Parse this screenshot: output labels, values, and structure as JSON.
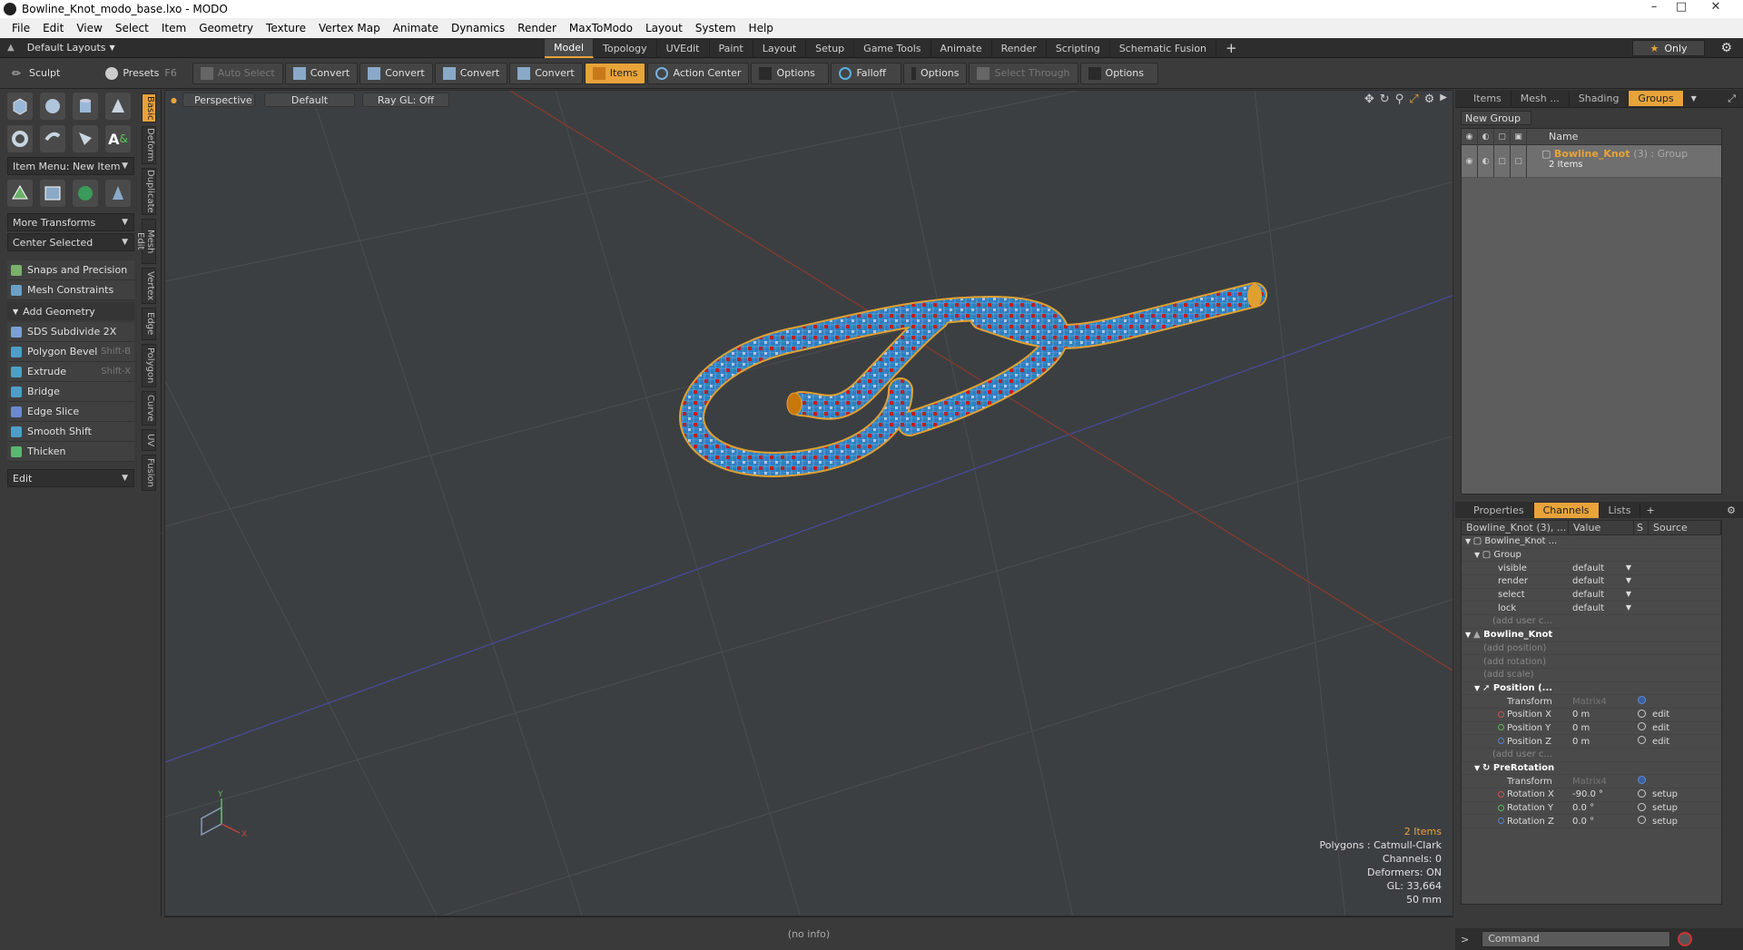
{
  "window": {
    "title": "Bowline_Knot_modo_base.lxo - MODO"
  },
  "menu": [
    "File",
    "Edit",
    "View",
    "Select",
    "Item",
    "Geometry",
    "Texture",
    "Vertex Map",
    "Animate",
    "Dynamics",
    "Render",
    "MaxToModo",
    "Layout",
    "System",
    "Help"
  ],
  "layout": {
    "default_layouts": "Default Layouts",
    "tabs": [
      "Model",
      "Topology",
      "UVEdit",
      "Paint",
      "Layout",
      "Setup",
      "Game Tools",
      "Animate",
      "Render",
      "Scripting",
      "Schematic Fusion"
    ],
    "active_tab": "Model",
    "only_label": "Only"
  },
  "toolbar": {
    "sculpt": "Sculpt",
    "presets": "Presets",
    "presets_key": "F6",
    "auto_select": "Auto Select",
    "convert1": "Convert",
    "convert2": "Convert",
    "convert3": "Convert",
    "convert4": "Convert",
    "items": "Items",
    "action_center": "Action Center",
    "options1": "Options",
    "falloff": "Falloff",
    "options2": "Options",
    "select_through": "Select Through",
    "options3": "Options"
  },
  "left": {
    "item_menu": "Item Menu: New Item",
    "more_transforms": "More Transforms",
    "center_selected": "Center Selected",
    "snaps": "Snaps and Precision",
    "mesh_constraints": "Mesh Constraints",
    "add_geometry": "Add Geometry",
    "tools": [
      {
        "label": "SDS Subdivide 2X",
        "shortcut": "",
        "color": "#7aa0d8"
      },
      {
        "label": "Polygon Bevel",
        "shortcut": "Shift-B",
        "color": "#4aa0c8"
      },
      {
        "label": "Extrude",
        "shortcut": "Shift-X",
        "color": "#4aa0c8"
      },
      {
        "label": "Bridge",
        "shortcut": "",
        "color": "#4aa0c8"
      },
      {
        "label": "Edge Slice",
        "shortcut": "",
        "color": "#6a8ad0"
      },
      {
        "label": "Smooth Shift",
        "shortcut": "",
        "color": "#4aa0c8"
      },
      {
        "label": "Thicken",
        "shortcut": "",
        "color": "#5ab870"
      }
    ],
    "edit_dd": "Edit",
    "vtabs": [
      "Basic",
      "Deform",
      "Duplicate",
      "Mesh Edit",
      "Vertex",
      "Edge",
      "Polygon",
      "Curve",
      "UV",
      "Fusion"
    ]
  },
  "viewport": {
    "view": "Perspective",
    "shading": "Default",
    "raygl": "Ray GL: Off",
    "info": {
      "items": "2 Items",
      "polygons": "Polygons : Catmull-Clark",
      "channels": "Channels: 0",
      "deformers": "Deformers: ON",
      "gl": "GL: 33,664",
      "size": "50 mm"
    },
    "status": "(no info)"
  },
  "right": {
    "tabs": [
      "Items",
      "Mesh ...",
      "Shading",
      "Groups"
    ],
    "active_tab": "Groups",
    "new_group": "New Group",
    "list_header": "Name",
    "group": {
      "name": "Bowline_Knot",
      "suffix": "(3) : Group",
      "count": "2 Items"
    },
    "tabs2": [
      "Properties",
      "Channels",
      "Lists"
    ],
    "active_tab2": "Channels",
    "ch_header": {
      "name": "Bowline_Knot (3), ...",
      "value": "Value",
      "s": "S",
      "source": "Source"
    },
    "channels": [
      {
        "name": "Bowline_Knot ...",
        "value": "",
        "src": "",
        "type": "root"
      },
      {
        "name": "Group",
        "value": "",
        "src": "",
        "type": "node"
      },
      {
        "name": "visible",
        "value": "default",
        "src": "",
        "type": "dd"
      },
      {
        "name": "render",
        "value": "default",
        "src": "",
        "type": "dd"
      },
      {
        "name": "select",
        "value": "default",
        "src": "",
        "type": "dd"
      },
      {
        "name": "lock",
        "value": "default",
        "src": "",
        "type": "dd"
      },
      {
        "name": "(add user c...",
        "value": "",
        "src": "",
        "type": "dim"
      },
      {
        "name": "Bowline_Knot",
        "value": "",
        "src": "",
        "type": "bold"
      },
      {
        "name": "(add position)",
        "value": "",
        "src": "",
        "type": "dim"
      },
      {
        "name": "(add rotation)",
        "value": "",
        "src": "",
        "type": "dim"
      },
      {
        "name": "(add scale)",
        "value": "",
        "src": "",
        "type": "dim"
      },
      {
        "name": "Position (...",
        "value": "",
        "src": "",
        "type": "bold"
      },
      {
        "name": "Transform",
        "value": "Matrix4",
        "src": "",
        "type": "matrix"
      },
      {
        "name": "Position X",
        "value": "0 m",
        "src": "edit",
        "type": "px"
      },
      {
        "name": "Position Y",
        "value": "0 m",
        "src": "edit",
        "type": "py"
      },
      {
        "name": "Position Z",
        "value": "0 m",
        "src": "edit",
        "type": "pz"
      },
      {
        "name": "(add user c...",
        "value": "",
        "src": "",
        "type": "dim"
      },
      {
        "name": "PreRotation",
        "value": "",
        "src": "",
        "type": "node"
      },
      {
        "name": "Transform",
        "value": "Matrix4",
        "src": "",
        "type": "matrix"
      },
      {
        "name": "Rotation X",
        "value": "-90.0 °",
        "src": "setup",
        "type": "px"
      },
      {
        "name": "Rotation Y",
        "value": "0.0 °",
        "src": "setup",
        "type": "py"
      },
      {
        "name": "Rotation Z",
        "value": "0.0 °",
        "src": "setup",
        "type": "pz"
      }
    ],
    "command_placeholder": "Command"
  },
  "colors": {
    "accent": "#e8a33a",
    "rope_blue": "#2f7fc0",
    "rope_red": "#c02020",
    "wire": "#e0a030"
  }
}
